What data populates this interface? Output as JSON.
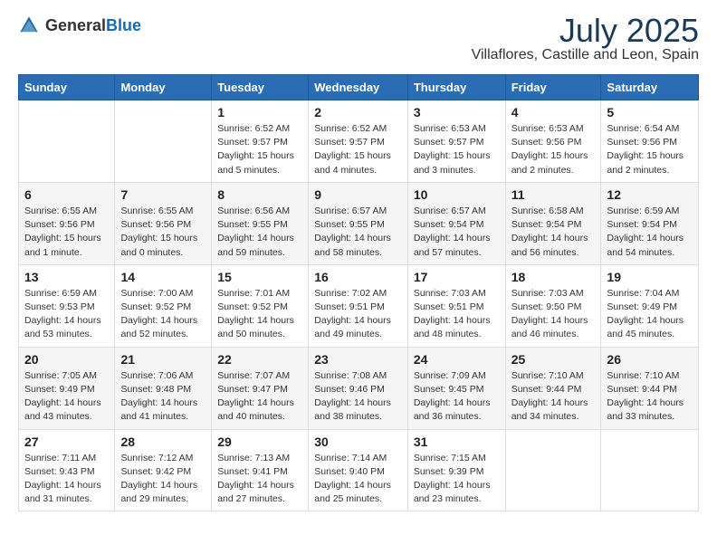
{
  "header": {
    "logo_general": "General",
    "logo_blue": "Blue",
    "month": "July 2025",
    "location": "Villaflores, Castille and Leon, Spain"
  },
  "days_of_week": [
    "Sunday",
    "Monday",
    "Tuesday",
    "Wednesday",
    "Thursday",
    "Friday",
    "Saturday"
  ],
  "weeks": [
    [
      {
        "day": "",
        "info": ""
      },
      {
        "day": "",
        "info": ""
      },
      {
        "day": "1",
        "info": "Sunrise: 6:52 AM\nSunset: 9:57 PM\nDaylight: 15 hours and 5 minutes."
      },
      {
        "day": "2",
        "info": "Sunrise: 6:52 AM\nSunset: 9:57 PM\nDaylight: 15 hours and 4 minutes."
      },
      {
        "day": "3",
        "info": "Sunrise: 6:53 AM\nSunset: 9:57 PM\nDaylight: 15 hours and 3 minutes."
      },
      {
        "day": "4",
        "info": "Sunrise: 6:53 AM\nSunset: 9:56 PM\nDaylight: 15 hours and 2 minutes."
      },
      {
        "day": "5",
        "info": "Sunrise: 6:54 AM\nSunset: 9:56 PM\nDaylight: 15 hours and 2 minutes."
      }
    ],
    [
      {
        "day": "6",
        "info": "Sunrise: 6:55 AM\nSunset: 9:56 PM\nDaylight: 15 hours and 1 minute."
      },
      {
        "day": "7",
        "info": "Sunrise: 6:55 AM\nSunset: 9:56 PM\nDaylight: 15 hours and 0 minutes."
      },
      {
        "day": "8",
        "info": "Sunrise: 6:56 AM\nSunset: 9:55 PM\nDaylight: 14 hours and 59 minutes."
      },
      {
        "day": "9",
        "info": "Sunrise: 6:57 AM\nSunset: 9:55 PM\nDaylight: 14 hours and 58 minutes."
      },
      {
        "day": "10",
        "info": "Sunrise: 6:57 AM\nSunset: 9:54 PM\nDaylight: 14 hours and 57 minutes."
      },
      {
        "day": "11",
        "info": "Sunrise: 6:58 AM\nSunset: 9:54 PM\nDaylight: 14 hours and 56 minutes."
      },
      {
        "day": "12",
        "info": "Sunrise: 6:59 AM\nSunset: 9:54 PM\nDaylight: 14 hours and 54 minutes."
      }
    ],
    [
      {
        "day": "13",
        "info": "Sunrise: 6:59 AM\nSunset: 9:53 PM\nDaylight: 14 hours and 53 minutes."
      },
      {
        "day": "14",
        "info": "Sunrise: 7:00 AM\nSunset: 9:52 PM\nDaylight: 14 hours and 52 minutes."
      },
      {
        "day": "15",
        "info": "Sunrise: 7:01 AM\nSunset: 9:52 PM\nDaylight: 14 hours and 50 minutes."
      },
      {
        "day": "16",
        "info": "Sunrise: 7:02 AM\nSunset: 9:51 PM\nDaylight: 14 hours and 49 minutes."
      },
      {
        "day": "17",
        "info": "Sunrise: 7:03 AM\nSunset: 9:51 PM\nDaylight: 14 hours and 48 minutes."
      },
      {
        "day": "18",
        "info": "Sunrise: 7:03 AM\nSunset: 9:50 PM\nDaylight: 14 hours and 46 minutes."
      },
      {
        "day": "19",
        "info": "Sunrise: 7:04 AM\nSunset: 9:49 PM\nDaylight: 14 hours and 45 minutes."
      }
    ],
    [
      {
        "day": "20",
        "info": "Sunrise: 7:05 AM\nSunset: 9:49 PM\nDaylight: 14 hours and 43 minutes."
      },
      {
        "day": "21",
        "info": "Sunrise: 7:06 AM\nSunset: 9:48 PM\nDaylight: 14 hours and 41 minutes."
      },
      {
        "day": "22",
        "info": "Sunrise: 7:07 AM\nSunset: 9:47 PM\nDaylight: 14 hours and 40 minutes."
      },
      {
        "day": "23",
        "info": "Sunrise: 7:08 AM\nSunset: 9:46 PM\nDaylight: 14 hours and 38 minutes."
      },
      {
        "day": "24",
        "info": "Sunrise: 7:09 AM\nSunset: 9:45 PM\nDaylight: 14 hours and 36 minutes."
      },
      {
        "day": "25",
        "info": "Sunrise: 7:10 AM\nSunset: 9:44 PM\nDaylight: 14 hours and 34 minutes."
      },
      {
        "day": "26",
        "info": "Sunrise: 7:10 AM\nSunset: 9:44 PM\nDaylight: 14 hours and 33 minutes."
      }
    ],
    [
      {
        "day": "27",
        "info": "Sunrise: 7:11 AM\nSunset: 9:43 PM\nDaylight: 14 hours and 31 minutes."
      },
      {
        "day": "28",
        "info": "Sunrise: 7:12 AM\nSunset: 9:42 PM\nDaylight: 14 hours and 29 minutes."
      },
      {
        "day": "29",
        "info": "Sunrise: 7:13 AM\nSunset: 9:41 PM\nDaylight: 14 hours and 27 minutes."
      },
      {
        "day": "30",
        "info": "Sunrise: 7:14 AM\nSunset: 9:40 PM\nDaylight: 14 hours and 25 minutes."
      },
      {
        "day": "31",
        "info": "Sunrise: 7:15 AM\nSunset: 9:39 PM\nDaylight: 14 hours and 23 minutes."
      },
      {
        "day": "",
        "info": ""
      },
      {
        "day": "",
        "info": ""
      }
    ]
  ]
}
